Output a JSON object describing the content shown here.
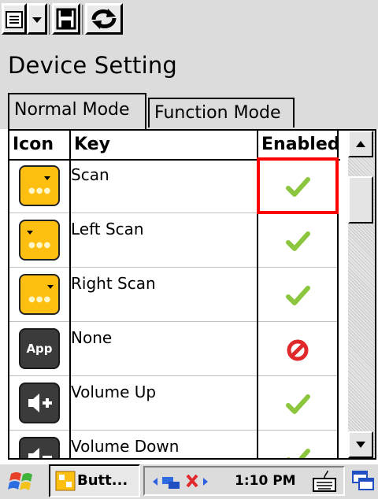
{
  "app": {
    "title": "Device Setting"
  },
  "tabs": [
    {
      "label": "Normal Mode",
      "active": true
    },
    {
      "label": "Function Mode",
      "active": false
    }
  ],
  "table": {
    "headers": [
      "Icon",
      "Key",
      "Enabled"
    ],
    "rows": [
      {
        "key": "Scan",
        "icon": "scan-key-icon",
        "enabled": true
      },
      {
        "key": "Left Scan",
        "icon": "left-scan-key-icon",
        "enabled": true
      },
      {
        "key": "Right Scan",
        "icon": "right-scan-key-icon",
        "enabled": true
      },
      {
        "key": "None",
        "icon": "app-key-icon",
        "icon_text": "App",
        "enabled": false
      },
      {
        "key": "Volume Up",
        "icon": "volume-up-key-icon",
        "enabled": true
      },
      {
        "key": "Volume Down",
        "icon": "volume-down-key-icon",
        "enabled": true
      }
    ]
  },
  "taskbar": {
    "task_label": "Butt...",
    "clock": "1:10 PM"
  },
  "colors": {
    "accent_yellow": "#ffbf10",
    "highlight_red": "#ff0000",
    "check_green": "#8cc63f",
    "disabled_red": "#e0292b"
  }
}
